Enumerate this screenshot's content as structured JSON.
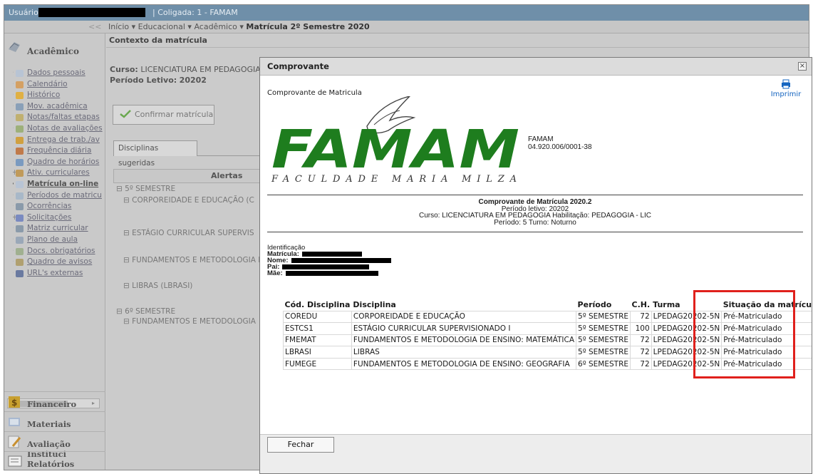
{
  "topbar": {
    "user_label": "Usuário:",
    "coligada": "| Coligada: 1 - FAMAM"
  },
  "breadcrumb": {
    "collapse": "<<",
    "inicio": "Início ▾",
    "educacional": "Educacional ▾",
    "academico": "Acadêmico ▾",
    "current": "Matrícula 2º Semestre 2020"
  },
  "sidebar": {
    "header": "Acadêmico",
    "items": [
      {
        "label": "Dados pessoais",
        "icon_color": "#b8c4d4"
      },
      {
        "label": "Calendário",
        "icon_color": "#d4a063"
      },
      {
        "label": "Histórico",
        "icon_color": "#e0b043"
      },
      {
        "label": "Mov. acadêmica",
        "icon_color": "#8aa0b8"
      },
      {
        "label": "Notas/faltas etapas",
        "icon_color": "#c0b070"
      },
      {
        "label": "Notas de avaliações",
        "icon_color": "#9db07a"
      },
      {
        "label": "Entrega de trab./av",
        "icon_color": "#d0a040"
      },
      {
        "label": "Frequência diária",
        "icon_color": "#c07a4a"
      },
      {
        "label": "Quadro de horários",
        "icon_color": "#7a9ac0"
      },
      {
        "label": "Ativ. curriculares",
        "icon_color": "#c09a5a"
      },
      {
        "label": "Matrícula on-line",
        "icon_color": "#b8c4d4"
      },
      {
        "label": "Períodos de matricu",
        "icon_color": "#a8b8c8"
      },
      {
        "label": "Ocorrências",
        "icon_color": "#8a9aaa"
      },
      {
        "label": "Solicitações",
        "icon_color": "#7a8ac0"
      },
      {
        "label": "Matriz curricular",
        "icon_color": "#8a9aaa"
      },
      {
        "label": "Plano de aula",
        "icon_color": "#9aa8b8"
      },
      {
        "label": "Docs. obrigatórios",
        "icon_color": "#a0b090"
      },
      {
        "label": "Quadro de avisos",
        "icon_color": "#b0a070"
      },
      {
        "label": "URL's externas",
        "icon_color": "#6a7aa0"
      }
    ],
    "bottom": [
      "Financeiro",
      "Materiais",
      "Avaliação Instituci",
      "Relatórios"
    ]
  },
  "main": {
    "context_header": "Contexto da matrícula",
    "curso_label": "Curso:",
    "curso_value": "LICENCIATURA EM PEDAGOGIA",
    "periodo_label": "Período Letivo:",
    "periodo_value": "20202",
    "confirm_button": "Confirmar matrícula",
    "tab": "Disciplinas sugeridas",
    "grid_header": "Alertas",
    "grid_rows": [
      "⊟ 5º SEMESTRE",
      "⊟ CORPOREIDADE E EDUCAÇÃO (C",
      "⊟ ESTÁGIO CURRICULAR SUPERVIS",
      "⊟ FUNDAMENTOS E METODOLOGIA I",
      "⊟ LIBRAS (LBRASI)",
      "⊟ 6º SEMESTRE",
      "⊟ FUNDAMENTOS E METODOLOGIA"
    ]
  },
  "modal": {
    "title": "Comprovante",
    "close": "×",
    "heading": "Comprovante de Matricula",
    "print_label": "Imprimir",
    "logo_text": "FAMAM",
    "logo_subtitle": "FACULDADE MARIA MILZA",
    "institution_name": "FAMAM",
    "cnpj": "04.920.006/0001-38",
    "receipt_title": "Comprovante de Matrícula 2020.2",
    "receipt_lines": [
      "Período letivo: 20202",
      "Curso: LICENCIATURA EM PEDAGOGIA Habilitação: PEDAGOGIA - LIC",
      "Período: 5 Turno: Noturno"
    ],
    "identification_header": "Identificação",
    "ident_fields": [
      "Matrícula:",
      "Nome:",
      "Pai:",
      "Mãe:"
    ],
    "table": {
      "headers": [
        "Cód. Disciplina",
        "Disciplina",
        "Período",
        "C.H.",
        "Turma",
        "Situação da matrícula"
      ],
      "rows": [
        [
          "COREDU",
          "CORPOREIDADE E EDUCAÇÃO",
          "5º SEMESTRE",
          "72",
          "LPEDAG20202-5N",
          "Pré-Matriculado"
        ],
        [
          "ESTCS1",
          "ESTÁGIO CURRICULAR SUPERVISIONADO I",
          "5º SEMESTRE",
          "100",
          "LPEDAG20202-5N",
          "Pré-Matriculado"
        ],
        [
          "FMEMAT",
          "FUNDAMENTOS E METODOLOGIA DE ENSINO: MATEMÁTICA",
          "5º SEMESTRE",
          "72",
          "LPEDAG20202-5N",
          "Pré-Matriculado"
        ],
        [
          "LBRASI",
          "LIBRAS",
          "5º SEMESTRE",
          "72",
          "LPEDAG20202-5N",
          "Pré-Matriculado"
        ],
        [
          "FUMEGE",
          "FUNDAMENTOS E METODOLOGIA DE ENSINO: GEOGRAFIA",
          "6º SEMESTRE",
          "72",
          "LPEDAG20202-5N",
          "Pré-Matriculado"
        ]
      ]
    },
    "close_button": "Fechar"
  },
  "colors": {
    "logo_green": "#1e7d1e",
    "highlight": "#e0201c",
    "link": "#1565c0"
  }
}
